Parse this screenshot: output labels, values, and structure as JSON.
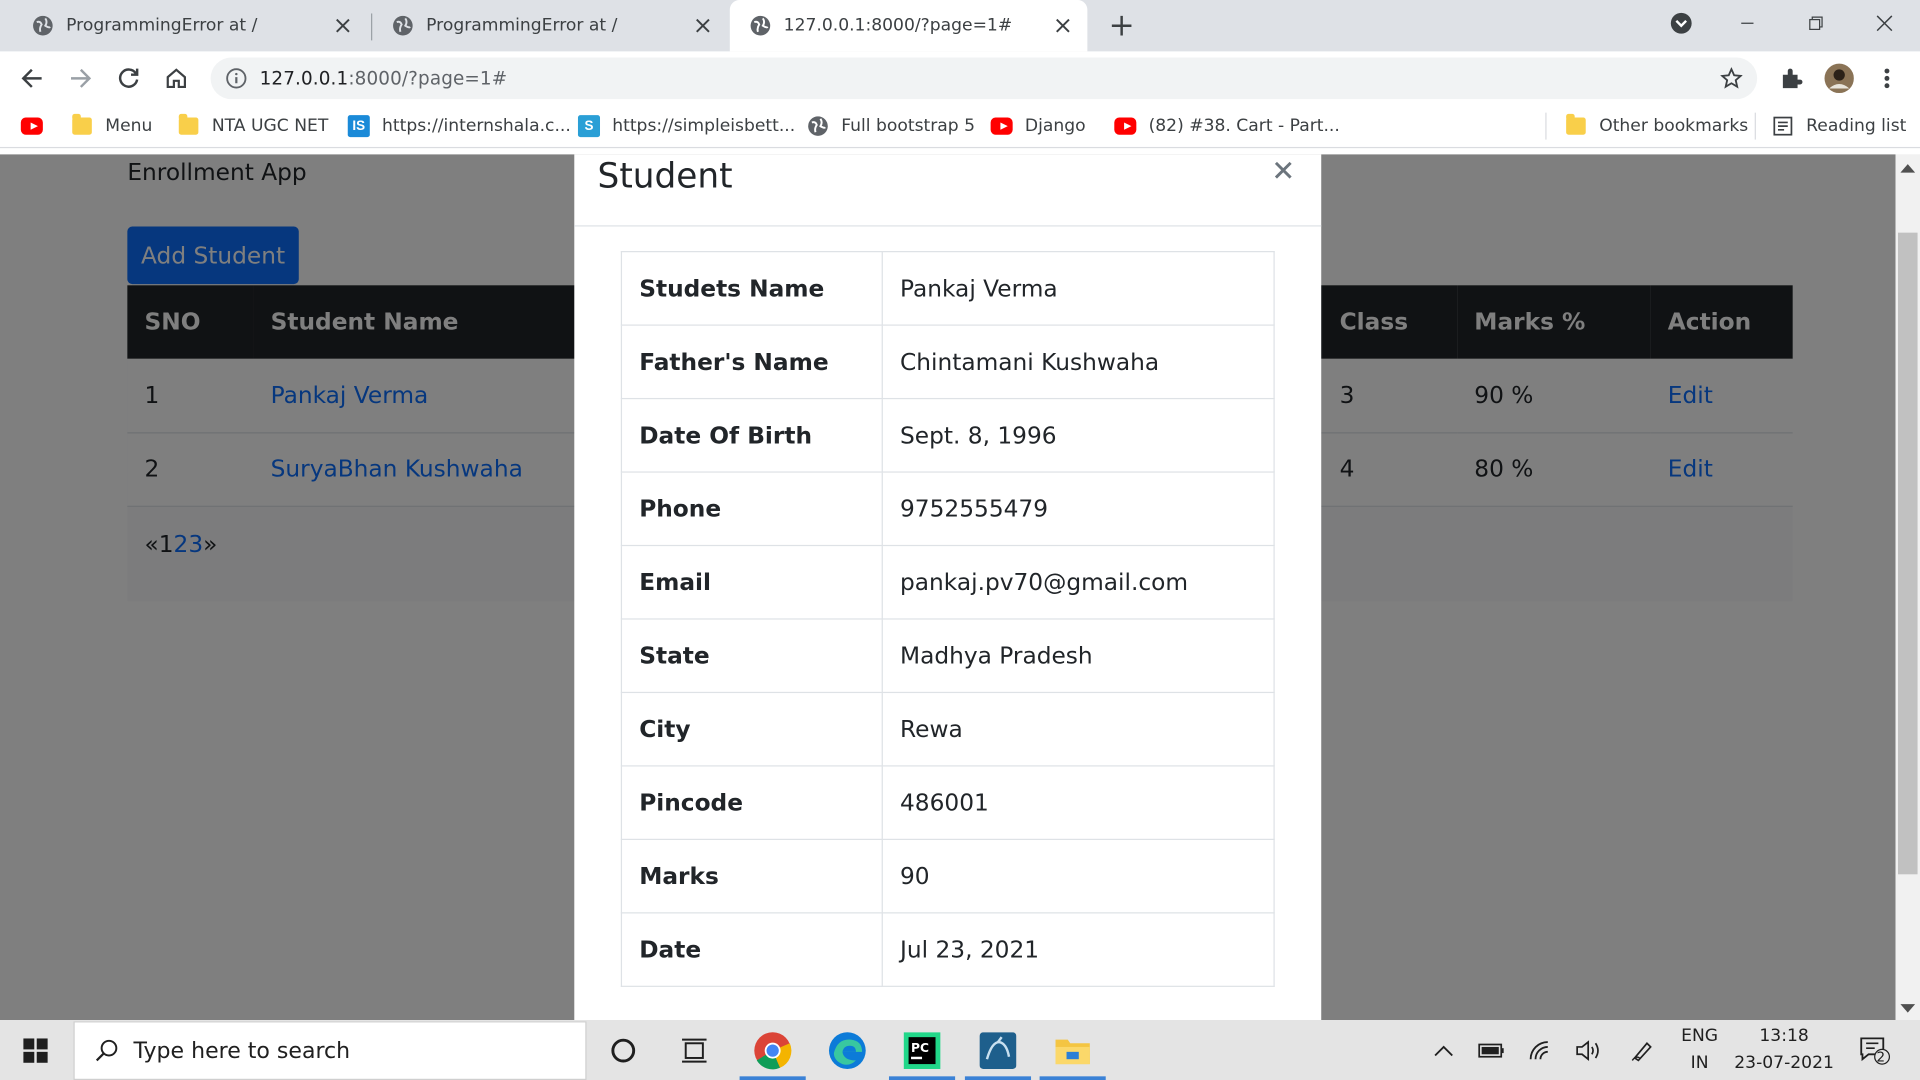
{
  "browser": {
    "tabs": [
      {
        "title": "ProgrammingError at /",
        "active": false
      },
      {
        "title": "ProgrammingError at /",
        "active": false
      },
      {
        "title": "127.0.0.1:8000/?page=1#",
        "active": true
      }
    ],
    "address": {
      "host": "127.0.0.1",
      "rest": ":8000/?page=1#"
    },
    "bookmarks": [
      {
        "label": "",
        "icon": "youtube-icon"
      },
      {
        "label": "Menu",
        "icon": "folder-icon"
      },
      {
        "label": "NTA UGC NET",
        "icon": "folder-icon"
      },
      {
        "label": "https://internshala.c...",
        "icon": "internshala-icon"
      },
      {
        "label": "https://simpleisbett...",
        "icon": "s-site-icon"
      },
      {
        "label": "Full bootstrap 5",
        "icon": "globe-icon"
      },
      {
        "label": "Django",
        "icon": "youtube-icon"
      },
      {
        "label": "(82) #38. Cart - Part...",
        "icon": "youtube-icon"
      }
    ],
    "other_bookmarks": "Other bookmarks",
    "reading_list": "Reading list"
  },
  "app": {
    "brand": "Enrollment App",
    "add_button": "Add Student",
    "table": {
      "headers": [
        "SNO",
        "Student Name",
        "Class",
        "Marks %",
        "Action"
      ],
      "rows": [
        {
          "sno": "1",
          "name": "Pankaj Verma",
          "class": "3",
          "marks": "90 %",
          "action": "Edit"
        },
        {
          "sno": "2",
          "name": "SuryaBhan Kushwaha",
          "class": "4",
          "marks": "80 %",
          "action": "Edit"
        }
      ]
    },
    "pagination": {
      "prev": "«",
      "current": "1",
      "pages": [
        "2",
        "3"
      ],
      "next": "»"
    }
  },
  "modal": {
    "title": "Student",
    "close": "×",
    "rows": [
      {
        "label": "Studets Name",
        "value": "Pankaj Verma"
      },
      {
        "label": "Father's Name",
        "value": "Chintamani Kushwaha"
      },
      {
        "label": "Date Of Birth",
        "value": "Sept. 8, 1996"
      },
      {
        "label": "Phone",
        "value": "9752555479"
      },
      {
        "label": "Email",
        "value": "pankaj.pv70@gmail.com"
      },
      {
        "label": "State",
        "value": "Madhya Pradesh"
      },
      {
        "label": "City",
        "value": "Rewa"
      },
      {
        "label": "Pincode",
        "value": "486001"
      },
      {
        "label": "Marks",
        "value": "90"
      },
      {
        "label": "Date",
        "value": "Jul 23, 2021"
      }
    ]
  },
  "taskbar": {
    "search_placeholder": "Type here to search",
    "language": "ENG",
    "region": "IN",
    "time": "13:18",
    "date": "23-07-2021",
    "notifications": "2"
  },
  "colors": {
    "primary": "#0d6efd",
    "table_header": "#212529",
    "tab_strip": "#dee1e6",
    "youtube_red": "#ff0000"
  }
}
